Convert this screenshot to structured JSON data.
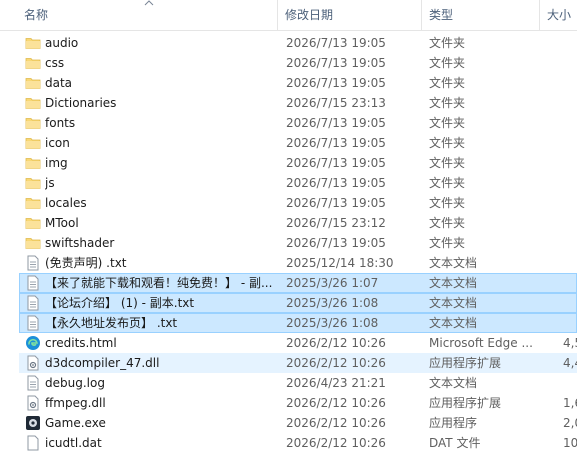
{
  "columns": {
    "name": "名称",
    "date": "修改日期",
    "type": "类型",
    "size": "大小"
  },
  "icons": {
    "folder": "folder-icon",
    "text": "text-file-icon",
    "edge": "edge-icon",
    "dll": "dll-file-icon",
    "game": "game-exe-icon",
    "generic": "file-icon"
  },
  "files": [
    {
      "name": "audio",
      "date": "2026/7/13 19:05",
      "type": "文件夹",
      "size": "",
      "icon": "folder",
      "state": ""
    },
    {
      "name": "css",
      "date": "2026/7/13 19:05",
      "type": "文件夹",
      "size": "",
      "icon": "folder",
      "state": ""
    },
    {
      "name": "data",
      "date": "2026/7/13 19:05",
      "type": "文件夹",
      "size": "",
      "icon": "folder",
      "state": ""
    },
    {
      "name": "Dictionaries",
      "date": "2026/7/15 23:13",
      "type": "文件夹",
      "size": "",
      "icon": "folder",
      "state": ""
    },
    {
      "name": "fonts",
      "date": "2026/7/13 19:05",
      "type": "文件夹",
      "size": "",
      "icon": "folder",
      "state": ""
    },
    {
      "name": "icon",
      "date": "2026/7/13 19:05",
      "type": "文件夹",
      "size": "",
      "icon": "folder",
      "state": ""
    },
    {
      "name": "img",
      "date": "2026/7/13 19:05",
      "type": "文件夹",
      "size": "",
      "icon": "folder",
      "state": ""
    },
    {
      "name": "js",
      "date": "2026/7/13 19:05",
      "type": "文件夹",
      "size": "",
      "icon": "folder",
      "state": ""
    },
    {
      "name": "locales",
      "date": "2026/7/13 19:05",
      "type": "文件夹",
      "size": "",
      "icon": "folder",
      "state": ""
    },
    {
      "name": "MTool",
      "date": "2026/7/15 23:12",
      "type": "文件夹",
      "size": "",
      "icon": "folder",
      "state": ""
    },
    {
      "name": "swiftshader",
      "date": "2026/7/13 19:05",
      "type": "文件夹",
      "size": "",
      "icon": "folder",
      "state": ""
    },
    {
      "name": "(免责声明) .txt",
      "date": "2025/12/14 18:30",
      "type": "文本文档",
      "size": "",
      "icon": "text",
      "state": ""
    },
    {
      "name": "【来了就能下载和观看！纯免费！】 - 副...",
      "date": "2025/3/26 1:07",
      "type": "文本文档",
      "size": "",
      "icon": "text",
      "state": "selected"
    },
    {
      "name": "【论坛介绍】 (1) - 副本.txt",
      "date": "2025/3/26 1:08",
      "type": "文本文档",
      "size": "",
      "icon": "text",
      "state": "selected"
    },
    {
      "name": "【永久地址发布页】 .txt",
      "date": "2025/3/26 1:08",
      "type": "文本文档",
      "size": "",
      "icon": "text",
      "state": "selected"
    },
    {
      "name": "credits.html",
      "date": "2026/2/12 10:26",
      "type": "Microsoft Edge ...",
      "size": "4,5",
      "icon": "edge",
      "state": ""
    },
    {
      "name": "d3dcompiler_47.dll",
      "date": "2026/2/12 10:26",
      "type": "应用程序扩展",
      "size": "4,4",
      "icon": "dll",
      "state": "hover"
    },
    {
      "name": "debug.log",
      "date": "2026/4/23 21:21",
      "type": "文本文档",
      "size": "",
      "icon": "text",
      "state": ""
    },
    {
      "name": "ffmpeg.dll",
      "date": "2026/2/12 10:26",
      "type": "应用程序扩展",
      "size": "1,6",
      "icon": "dll",
      "state": ""
    },
    {
      "name": "Game.exe",
      "date": "2026/2/12 10:26",
      "type": "应用程序",
      "size": "2,0",
      "icon": "game",
      "state": ""
    },
    {
      "name": "icudtl.dat",
      "date": "2026/2/12 10:26",
      "type": "DAT 文件",
      "size": "10,",
      "icon": "generic",
      "state": ""
    }
  ]
}
